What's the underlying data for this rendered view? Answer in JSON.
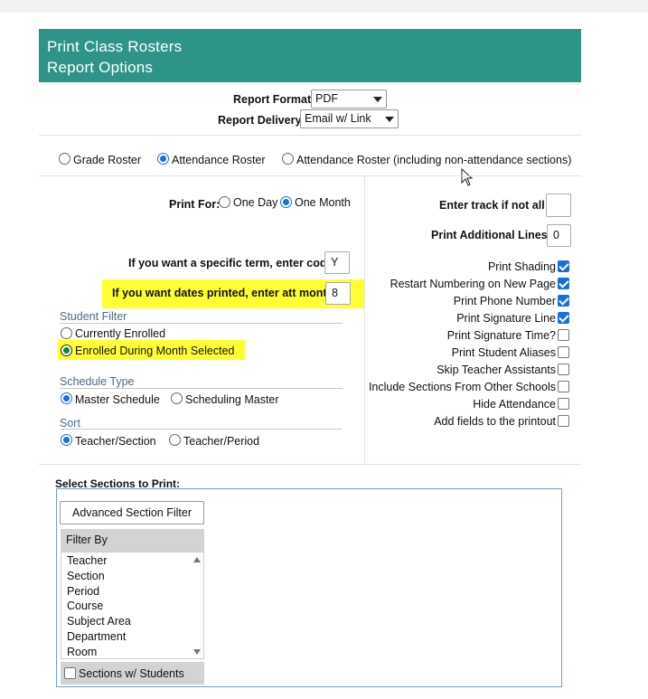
{
  "header": {
    "line1": "Print Class Rosters",
    "line2": "Report Options"
  },
  "report_format": {
    "label": "Report Format:",
    "value": "PDF"
  },
  "report_delivery": {
    "label": "Report Delivery:",
    "value": "Email w/ Link"
  },
  "roster_types": [
    {
      "label": "Grade Roster",
      "selected": false
    },
    {
      "label": "Attendance Roster",
      "selected": true
    },
    {
      "label": "Attendance Roster (including non-attendance sections)",
      "selected": false
    }
  ],
  "print_for": {
    "label": "Print For:",
    "options": [
      {
        "label": "One Day",
        "selected": false
      },
      {
        "label": "One Month",
        "selected": true
      }
    ]
  },
  "specific_term": {
    "label": "If you want a specific term, enter code",
    "value": "Y"
  },
  "dates_printed": {
    "label": "If you want dates printed, enter att month",
    "value": "8"
  },
  "student_filter": {
    "title": "Student Filter",
    "options": [
      {
        "label": "Currently Enrolled",
        "selected": false
      },
      {
        "label": "Enrolled During Month Selected",
        "selected": true
      }
    ]
  },
  "schedule_type": {
    "title": "Schedule Type",
    "options": [
      {
        "label": "Master Schedule",
        "selected": true
      },
      {
        "label": "Scheduling Master",
        "selected": false
      }
    ]
  },
  "sort": {
    "title": "Sort",
    "options": [
      {
        "label": "Teacher/Section",
        "selected": true
      },
      {
        "label": "Teacher/Period",
        "selected": false
      }
    ]
  },
  "track": {
    "label": "Enter track if not all",
    "value": ""
  },
  "additional_lines": {
    "label": "Print Additional Lines",
    "value": "0"
  },
  "checkboxes": [
    {
      "label": "Print Shading",
      "checked": true
    },
    {
      "label": "Restart Numbering on New Page",
      "checked": true
    },
    {
      "label": "Print Phone Number",
      "checked": true
    },
    {
      "label": "Print Signature Line",
      "checked": true
    },
    {
      "label": "Print Signature Time?",
      "checked": false
    },
    {
      "label": "Print Student Aliases",
      "checked": false
    },
    {
      "label": "Skip Teacher Assistants",
      "checked": false
    },
    {
      "label": "Include Sections From Other Schools",
      "checked": false
    },
    {
      "label": "Hide Attendance",
      "checked": false
    },
    {
      "label": "Add fields to the printout",
      "checked": false
    }
  ],
  "sections": {
    "title": "Select Sections to Print:",
    "advanced_filter_label": "Advanced Section Filter",
    "filter_by_label": "Filter By",
    "filter_items": [
      "Teacher",
      "Section",
      "Period",
      "Course",
      "Subject Area",
      "Department",
      "Room"
    ],
    "with_students_label": "Sections w/ Students"
  },
  "colors": {
    "header": "#2e9488",
    "highlight": "#ffff33",
    "accent": "#1a6fd8"
  }
}
